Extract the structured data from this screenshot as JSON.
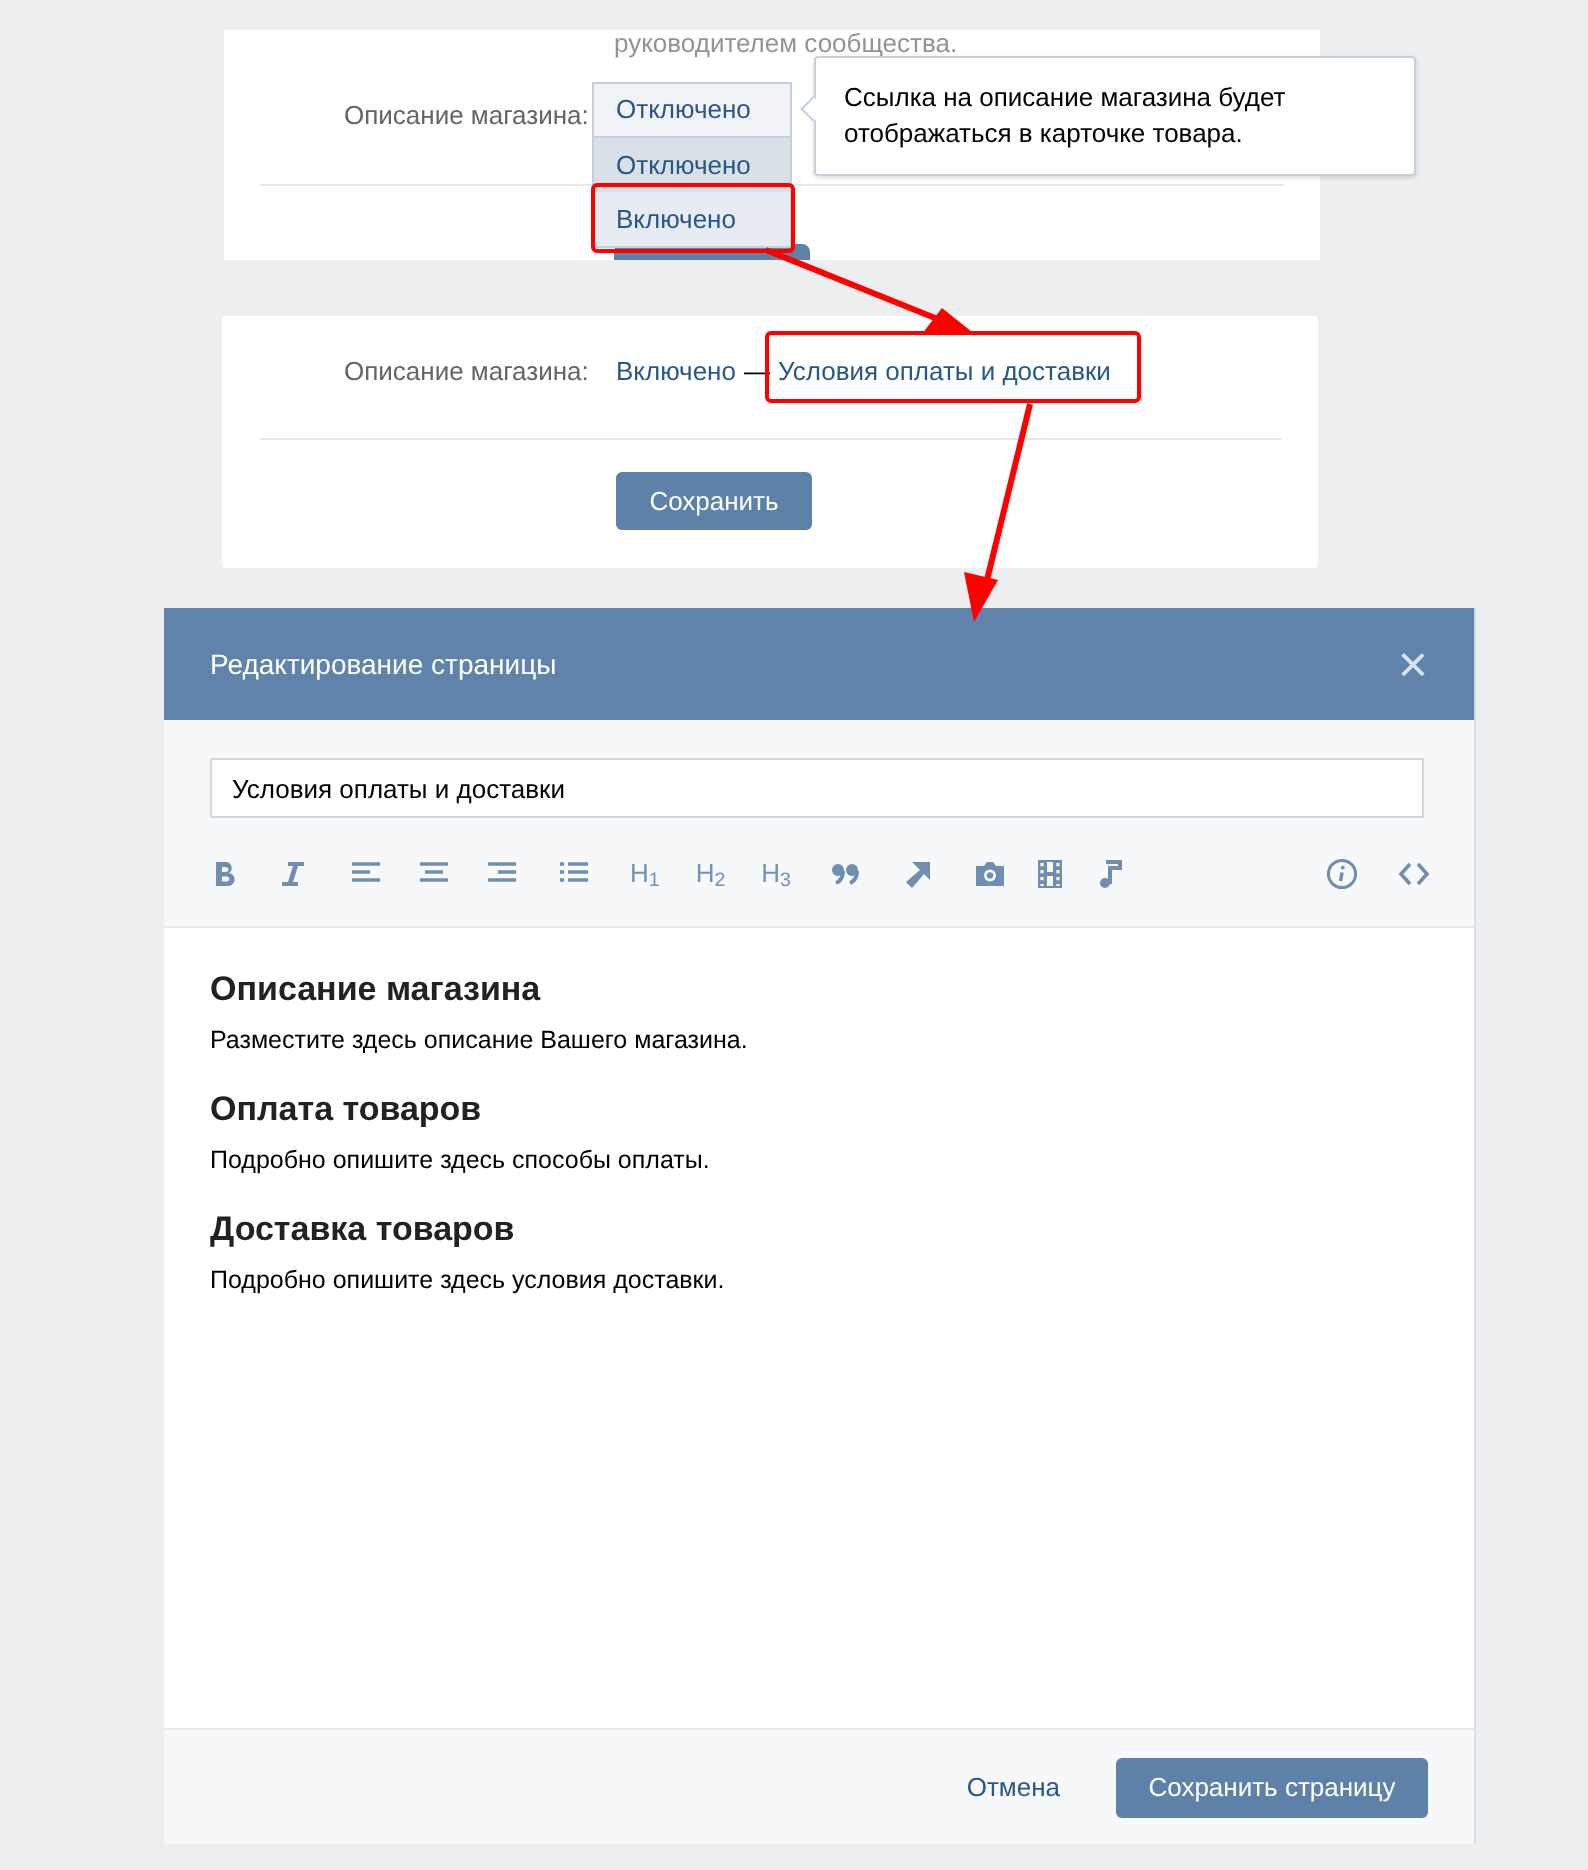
{
  "settings_card_top": {
    "note": "руководителем сообщества.",
    "label": "Описание магазина:",
    "select": {
      "value": "Отключено",
      "options": [
        {
          "label": "Отключено",
          "selected": true
        },
        {
          "label": "Включено",
          "selected": false
        }
      ]
    },
    "tooltip": "Ссылка на описание магазина будет отображаться в карточке товара."
  },
  "settings_card_bottom": {
    "label": "Описание магазина:",
    "value": "Включено",
    "separator": "—",
    "link": "Условия оплаты и доставки",
    "button": "Сохранить"
  },
  "modal": {
    "title": "Редактирование страницы",
    "close": "×",
    "title_field": "Условия оплаты и доставки",
    "toolbar": [
      {
        "kind": "bold"
      },
      {
        "kind": "italic"
      },
      {
        "kind": "align-left"
      },
      {
        "kind": "align-center"
      },
      {
        "kind": "align-right"
      },
      {
        "kind": "list"
      },
      {
        "kind": "heading",
        "label": "H$_{1}$"
      },
      {
        "kind": "heading",
        "label": "H$_{2}$"
      },
      {
        "kind": "heading",
        "label": "H$_{3}$"
      },
      {
        "kind": "quote"
      },
      {
        "kind": "link"
      },
      {
        "kind": "photo"
      },
      {
        "kind": "video"
      },
      {
        "kind": "audio"
      }
    ],
    "toolbar_right": [
      {
        "kind": "info"
      },
      {
        "kind": "code"
      }
    ],
    "content": [
      {
        "kind": "heading",
        "text": "Описание магазина"
      },
      {
        "kind": "paragraph",
        "text": "Разместите здесь описание Вашего магазина."
      },
      {
        "kind": "heading",
        "text": "Оплата товаров"
      },
      {
        "kind": "paragraph",
        "text": "Подробно опишите здесь способы оплаты."
      },
      {
        "kind": "heading",
        "text": "Доставка товаров"
      },
      {
        "kind": "paragraph",
        "text": "Подробно опишите здесь условия доставки."
      }
    ],
    "cancel": "Отмена",
    "save": "Сохранить страницу"
  }
}
